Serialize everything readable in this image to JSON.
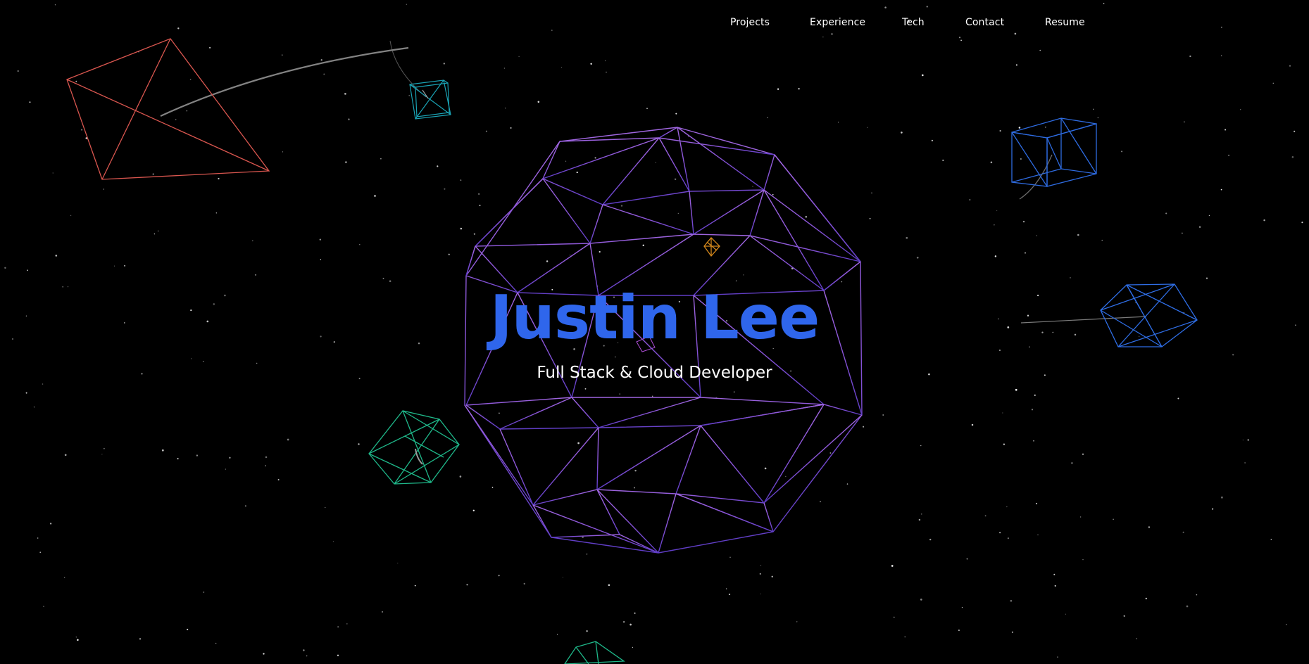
{
  "nav": {
    "items": [
      {
        "label": "Projects"
      },
      {
        "label": "Experience"
      },
      {
        "label": "Tech"
      },
      {
        "label": "Contact"
      },
      {
        "label": "Resume"
      }
    ]
  },
  "hero": {
    "title": "Justin Lee",
    "subtitle": "Full Stack & Cloud Developer"
  },
  "colors": {
    "background": "#000000",
    "title": "#2f66ec",
    "text": "#ffffff",
    "sphere": "#8a55d8",
    "octahedron_red": "#d9564f",
    "cube_teal": "#1aa3b5",
    "cube_blue": "#2e6be0",
    "octahedron_blue": "#2f6ee6",
    "polyhedron_green": "#1fb88a",
    "small_orange": "#d88a1c"
  },
  "scene": {
    "background_type": "starfield",
    "objects": [
      {
        "name": "wireframe-sphere",
        "shape": "geodesic"
      },
      {
        "name": "octahedron-red",
        "shape": "octahedron"
      },
      {
        "name": "cube-teal",
        "shape": "cube"
      },
      {
        "name": "cube-blue",
        "shape": "cube"
      },
      {
        "name": "octahedron-blue",
        "shape": "octahedron"
      },
      {
        "name": "polyhedron-green",
        "shape": "icosahedron"
      },
      {
        "name": "polyhedron-orange",
        "shape": "octahedron"
      },
      {
        "name": "polyhedron-green-bottom",
        "shape": "octahedron"
      }
    ]
  }
}
